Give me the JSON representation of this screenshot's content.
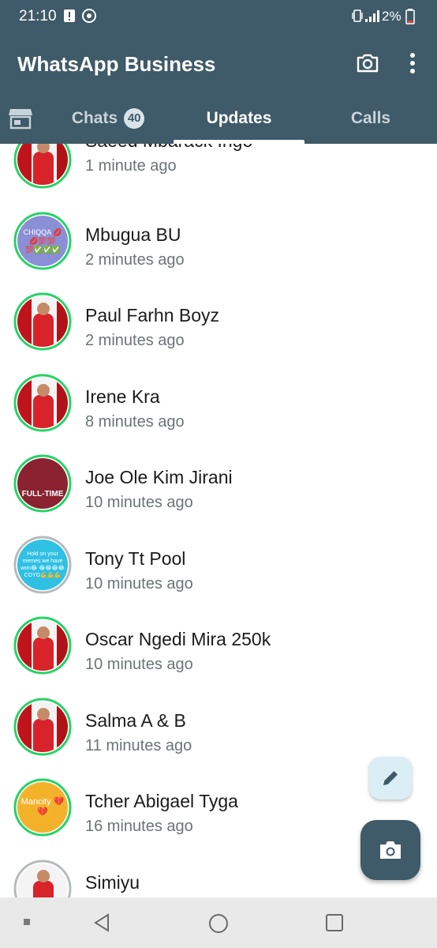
{
  "status_bar": {
    "time": "21:10",
    "battery": "2%",
    "icons": [
      "alert-icon",
      "chrome-icon",
      "vibrate-icon",
      "signal-icon",
      "battery-icon"
    ]
  },
  "app_bar": {
    "title": "WhatsApp Business",
    "icons": [
      "camera-icon",
      "more-vert-icon"
    ]
  },
  "tabs": {
    "store_icon": "store-icon",
    "items": [
      {
        "label": "Chats",
        "badge": "40"
      },
      {
        "label": "Updates"
      },
      {
        "label": "Calls"
      }
    ],
    "selected": "Updates"
  },
  "updates": [
    {
      "name": "Saeed Mbarack Ingo",
      "time": "1 minute ago",
      "avatar": "player"
    },
    {
      "name": "Mbugua BU",
      "time": "2 minutes ago",
      "avatar": "purple",
      "avatar_text": "CHIQQA 💋💋💯💯 💯✅✅✅"
    },
    {
      "name": "Paul Farhn Boyz",
      "time": "2 minutes ago",
      "avatar": "player"
    },
    {
      "name": "Irene Kra",
      "time": "8 minutes ago",
      "avatar": "player"
    },
    {
      "name": "Joe Ole Kim Jirani",
      "time": "10 minutes ago",
      "avatar": "fulltime",
      "avatar_text": "FULL-TIME"
    },
    {
      "name": "Tony Tt Pool",
      "time": "10 minutes ago",
      "avatar": "cyan",
      "avatar_text": "Hold on your memes we have won😂 😂😂😂😂 COYG💪💪💪"
    },
    {
      "name": "Oscar Ngedi Mira 250k",
      "time": "10 minutes ago",
      "avatar": "player"
    },
    {
      "name": "Salma A & B",
      "time": "11 minutes ago",
      "avatar": "player"
    },
    {
      "name": "Tcher Abigael Tyga",
      "time": "16 minutes ago",
      "avatar": "orange",
      "avatar_text": "Mancity 💔💔"
    },
    {
      "name": "Simiyu",
      "time": "",
      "avatar": "player"
    }
  ],
  "fabs": {
    "edit_icon": "pencil-icon",
    "camera_icon": "camera-icon"
  },
  "nav_bar": {
    "icons": [
      "recents-dot-icon",
      "back-icon",
      "home-icon",
      "overview-icon"
    ]
  },
  "colors": {
    "header": "#3f5a68",
    "ring_green": "#25d366",
    "ring_gray": "#b5bbbd",
    "fab_light": "#dbeef5"
  }
}
